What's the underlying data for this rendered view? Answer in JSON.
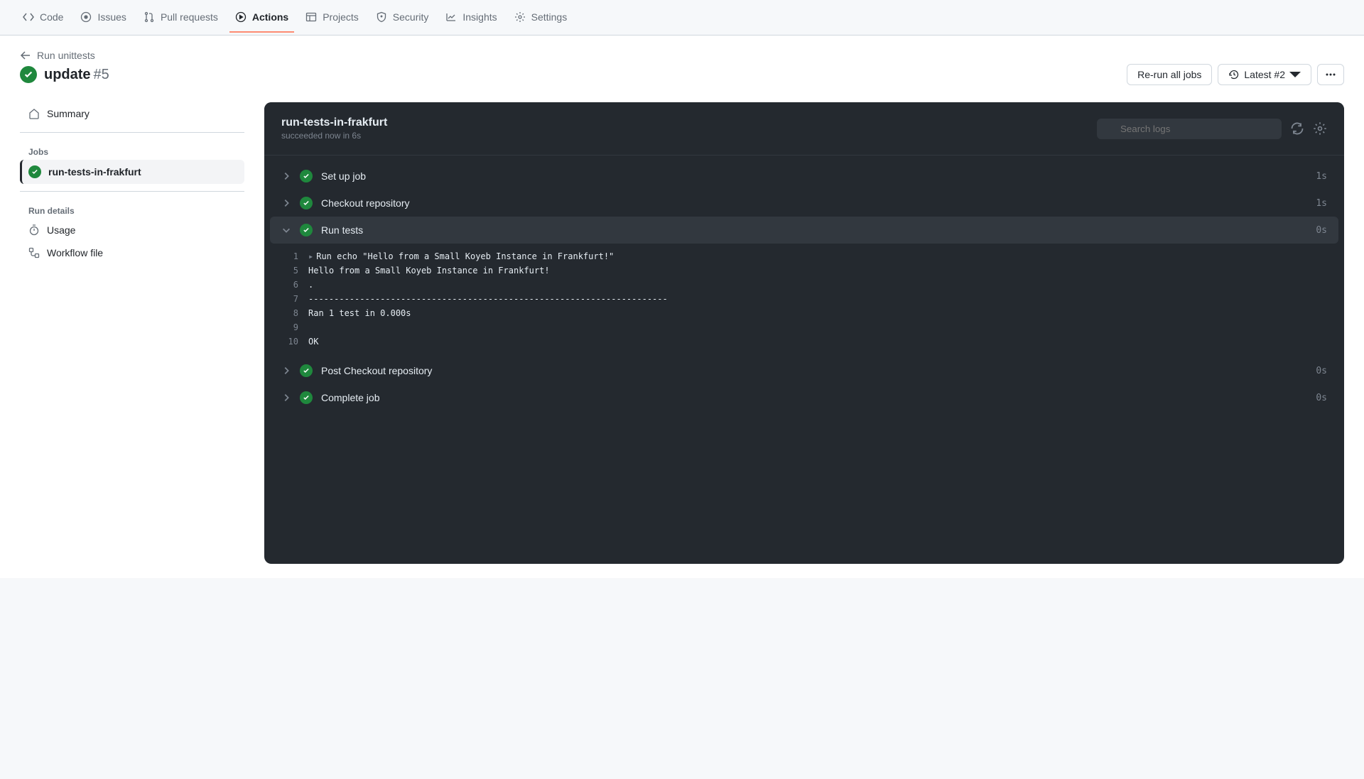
{
  "nav": {
    "code": "Code",
    "issues": "Issues",
    "pulls": "Pull requests",
    "actions": "Actions",
    "projects": "Projects",
    "security": "Security",
    "insights": "Insights",
    "settings": "Settings"
  },
  "breadcrumb": {
    "workflow": "Run unittests"
  },
  "title": {
    "name": "update",
    "number": "#5"
  },
  "actions": {
    "rerun": "Re-run all jobs",
    "latest": "Latest #2"
  },
  "sidebar": {
    "summary": "Summary",
    "jobs_header": "Jobs",
    "job_name": "run-tests-in-frakfurt",
    "details_header": "Run details",
    "usage": "Usage",
    "workflow_file": "Workflow file"
  },
  "job": {
    "title": "run-tests-in-frakfurt",
    "subtitle": "succeeded now in 6s",
    "search_placeholder": "Search logs"
  },
  "steps": [
    {
      "name": "Set up job",
      "time": "1s",
      "expanded": false
    },
    {
      "name": "Checkout repository",
      "time": "1s",
      "expanded": false
    },
    {
      "name": "Run tests",
      "time": "0s",
      "expanded": true
    },
    {
      "name": "Post Checkout repository",
      "time": "0s",
      "expanded": false
    },
    {
      "name": "Complete job",
      "time": "0s",
      "expanded": false
    }
  ],
  "log": [
    {
      "num": "1",
      "text": "Run echo \"Hello from a Small Koyeb Instance in Frankfurt!\"",
      "expandable": true
    },
    {
      "num": "5",
      "text": "Hello from a Small Koyeb Instance in Frankfurt!"
    },
    {
      "num": "6",
      "text": "."
    },
    {
      "num": "7",
      "text": "----------------------------------------------------------------------"
    },
    {
      "num": "8",
      "text": "Ran 1 test in 0.000s"
    },
    {
      "num": "9",
      "text": ""
    },
    {
      "num": "10",
      "text": "OK"
    }
  ]
}
